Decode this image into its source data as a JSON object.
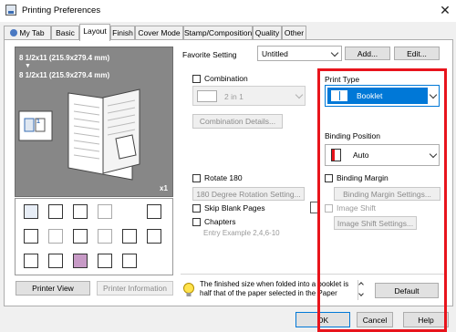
{
  "window": {
    "title": "Printing Preferences",
    "close_glyph": "✕"
  },
  "tabs": [
    {
      "label": "My Tab"
    },
    {
      "label": "Basic"
    },
    {
      "label": "Layout"
    },
    {
      "label": "Finish"
    },
    {
      "label": "Cover Mode"
    },
    {
      "label": "Stamp/Composition"
    },
    {
      "label": "Quality"
    },
    {
      "label": "Other"
    }
  ],
  "active_tab": "Layout",
  "preview": {
    "paper_original": "8 1/2x11 (215.9x279.4 mm)",
    "arrow": "▼",
    "paper_output": "8 1/2x11 (215.9x279.4 mm)",
    "zoom": "x1",
    "page_number": "1"
  },
  "favorite": {
    "label": "Favorite Setting",
    "value": "Untitled",
    "add_label": "Add...",
    "edit_label": "Edit..."
  },
  "combination": {
    "label": "Combination",
    "checked": false,
    "value": "2 in 1",
    "details_label": "Combination Details..."
  },
  "print_type": {
    "label": "Print Type",
    "value": "Booklet"
  },
  "binding_position": {
    "label": "Binding Position",
    "value": "Auto"
  },
  "binding_margin": {
    "label": "Binding Margin",
    "checked": false,
    "settings_label": "Binding Margin Settings..."
  },
  "image_shift": {
    "label": "Image Shift",
    "checked": false,
    "settings_label": "Image Shift Settings..."
  },
  "rotate180": {
    "label": "Rotate 180",
    "checked": false,
    "settings_label": "180 Degree Rotation Setting..."
  },
  "skip_blank": {
    "label": "Skip Blank Pages",
    "checked": false
  },
  "chapters": {
    "label": "Chapters",
    "checked": false,
    "placeholder": "Entry Example 2,4,6-10"
  },
  "buttons": {
    "printer_view": "Printer View",
    "printer_information": "Printer Information",
    "default": "Default",
    "ok": "OK",
    "cancel": "Cancel",
    "help": "Help"
  },
  "hint": {
    "text": "The finished size when folded into a booklet is half that of the paper selected in the Paper",
    "icon": "lightbulb-icon"
  },
  "colors": {
    "accent": "#0078d7",
    "highlight_box": "#e8141c"
  }
}
